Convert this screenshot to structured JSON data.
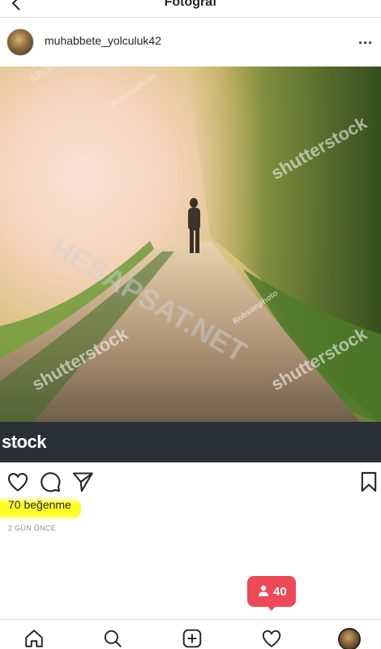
{
  "header": {
    "title": "Fotoğraf",
    "back_icon": "back-arrow-icon"
  },
  "post": {
    "username": "muhabbete_yolculuk42",
    "more_label": "...",
    "photo": {
      "alt": "",
      "watermarks": [
        "shutterstock",
        "shutterstock",
        "shutterstock",
        "shutterstock",
        "HESAPSAT.NET",
        "Robsonphoto",
        "Robsonphoto"
      ],
      "strip_text": "stock"
    },
    "likes_text": "70 beğenme",
    "time_text": "2 GÜN ÖNCE"
  },
  "notification": {
    "count": "40",
    "color": "#ed4956"
  },
  "bottom_nav": {
    "items": [
      "home-icon",
      "search-icon",
      "new-post-icon",
      "activity-heart-icon",
      "profile-avatar"
    ]
  },
  "colors": {
    "text": "#262626",
    "muted": "#8e8e8e",
    "divider": "#dbdbdb",
    "highlight": "#ffff00"
  }
}
